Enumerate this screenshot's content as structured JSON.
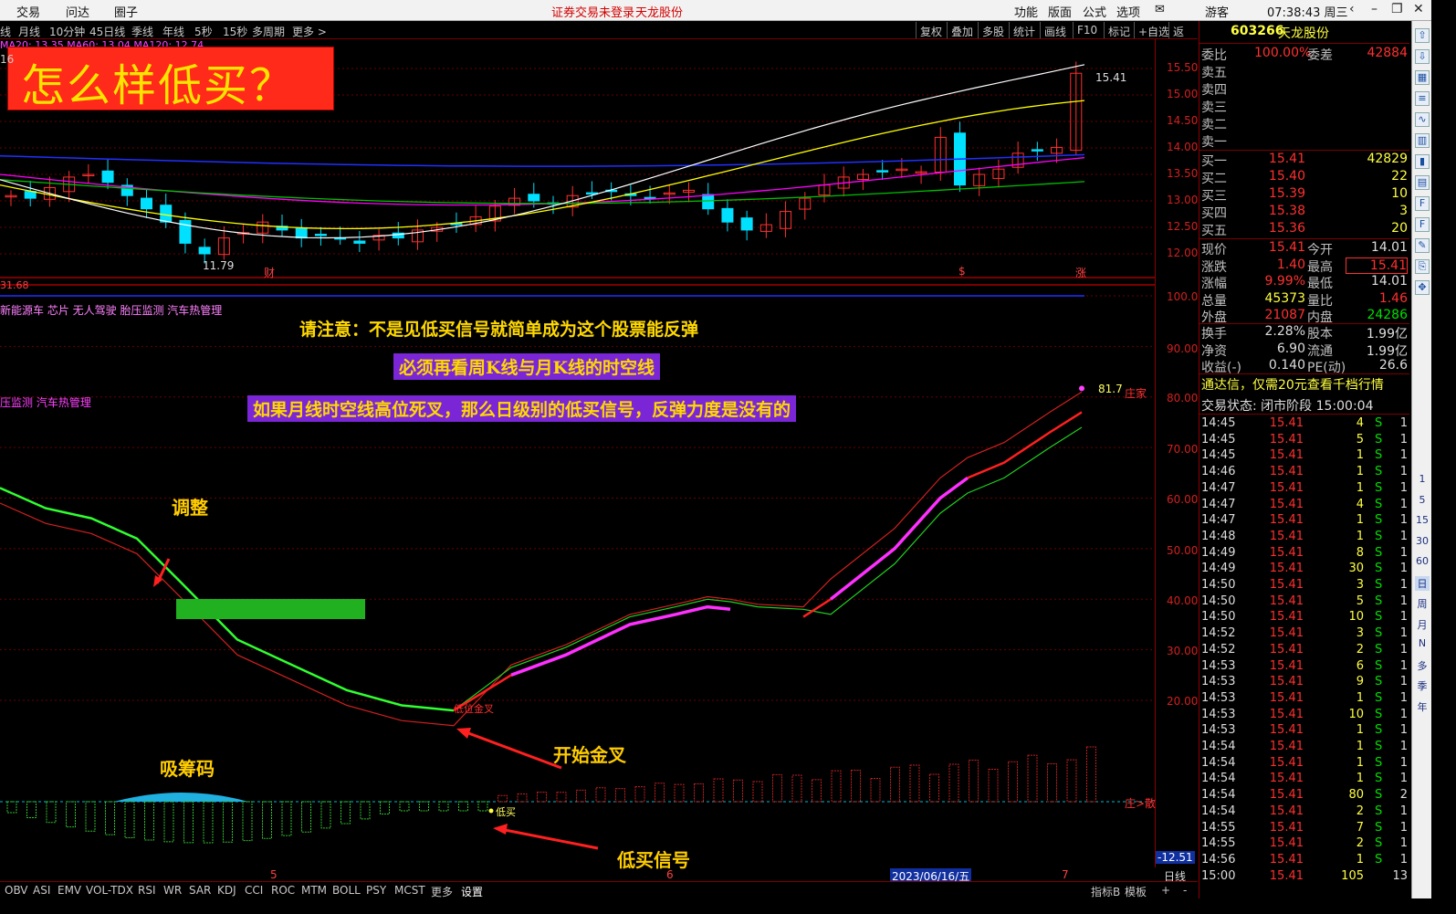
{
  "menubar": {
    "left_items": [
      "交易",
      "问达",
      "圈子"
    ],
    "center_notice_1": "证券交易未登录",
    "center_notice_2": "天龙股份",
    "right_items": [
      "功能",
      "版面",
      "公式",
      "选项"
    ],
    "user": "游客",
    "clock": "07:38:43 周三"
  },
  "toolbar": {
    "periods": [
      "线",
      "月线",
      "10分钟",
      "45日线",
      "季线",
      "年线",
      "5秒",
      "15秒",
      "多周期",
      "更多 >"
    ],
    "tools": [
      "复权",
      "叠加",
      "多股",
      "统计",
      "画线",
      "F10",
      "标记",
      "+自选",
      "返回"
    ],
    "ma_legend": "MA20: 13.35  MA60: 13.04  MA120: 12.74"
  },
  "main_chart": {
    "title_banner": "怎么样低买？",
    "y_ticks": [
      "15.50",
      "15.00",
      "14.50",
      "14.00",
      "13.50",
      "13.00",
      "12.50",
      "12.00"
    ],
    "high_label": "15.41",
    "low_label": "11.79",
    "left_value": "16",
    "left_bottom_value": "31.68",
    "bottom_markers": [
      "财",
      "$",
      "涨"
    ]
  },
  "indicator_chart": {
    "y_ticks": [
      "100.0",
      "90.00",
      "80.00",
      "70.00",
      "60.00",
      "50.00",
      "40.00",
      "30.00",
      "20.00"
    ],
    "concept_line_1": "新能源车 芯片 无人驾驶 胎压监测 汽车热管理",
    "concept_line_2": "压监测 汽车热管理",
    "end_value": "81.7",
    "end_tag": "庄家",
    "cross_label": "低位金叉"
  },
  "notes": {
    "note1": "请注意：不是见低买信号就简单成为这个股票能反弹",
    "note2": "必须再看周K线与月K线的时空线",
    "note3": "如果月线时空线高位死叉，那么日级别的低买信号，反弹力度是没有的"
  },
  "annotations": {
    "adjust": "调整",
    "golden_cross": "开始金叉",
    "absorb": "吸筹码",
    "low_buy_signal": "低买信号",
    "low_buy_tag": "低买",
    "zhuang_tag": "庄>散"
  },
  "bottom_panel": {
    "y_tick": "-12.51"
  },
  "x_axis": {
    "labels": [
      "5",
      "6",
      "2023/06/16/五",
      "7"
    ],
    "period": "日线"
  },
  "bottom_tabs": [
    "OBV",
    "ASI",
    "EMV",
    "VOL-TDX",
    "RSI",
    "WR",
    "SAR",
    "KDJ",
    "CCI",
    "ROC",
    "MTM",
    "BOLL",
    "PSY",
    "MCST",
    "更多",
    "设置"
  ],
  "bottom_right": [
    "指标B",
    "模板",
    "+",
    "-"
  ],
  "quote_panel": {
    "code": "603266",
    "name": "天龙股份",
    "weibi_label": "委比",
    "weibi": "100.00%",
    "weicha_label": "委差",
    "weicha": "42884",
    "sells": [
      {
        "label": "卖五",
        "price": "",
        "vol": ""
      },
      {
        "label": "卖四",
        "price": "",
        "vol": ""
      },
      {
        "label": "卖三",
        "price": "",
        "vol": ""
      },
      {
        "label": "卖二",
        "price": "",
        "vol": ""
      },
      {
        "label": "卖一",
        "price": "",
        "vol": ""
      }
    ],
    "buys": [
      {
        "label": "买一",
        "price": "15.41",
        "vol": "42829"
      },
      {
        "label": "买二",
        "price": "15.40",
        "vol": "22"
      },
      {
        "label": "买三",
        "price": "15.39",
        "vol": "10"
      },
      {
        "label": "买四",
        "price": "15.38",
        "vol": "3"
      },
      {
        "label": "买五",
        "price": "15.36",
        "vol": "20"
      }
    ],
    "stats": [
      {
        "l1": "现价",
        "v1": "15.41",
        "l2": "今开",
        "v2": "14.01"
      },
      {
        "l1": "涨跌",
        "v1": "1.40",
        "l2": "最高",
        "v2": "15.41"
      },
      {
        "l1": "涨幅",
        "v1": "9.99%",
        "l2": "最低",
        "v2": "14.01"
      },
      {
        "l1": "总量",
        "v1": "45373",
        "l2": "量比",
        "v2": "1.46"
      },
      {
        "l1": "外盘",
        "v1": "21087",
        "l2": "内盘",
        "v2": "24286"
      },
      {
        "l1": "换手",
        "v1": "2.28%",
        "l2": "股本",
        "v2": "1.99亿"
      },
      {
        "l1": "净资",
        "v1": "6.90",
        "l2": "流通",
        "v2": "1.99亿"
      },
      {
        "l1": "收益(-)",
        "v1": "0.140",
        "l2": "PE(动)",
        "v2": "26.6"
      }
    ],
    "promo": "通达信，仅需20元查看千档行情",
    "trade_status": "交易状态: 闭市阶段 15:00:04",
    "ticks": [
      {
        "t": "14:45",
        "p": "15.41",
        "v": "4",
        "s": "S",
        "n": "1"
      },
      {
        "t": "14:45",
        "p": "15.41",
        "v": "5",
        "s": "S",
        "n": "1"
      },
      {
        "t": "14:45",
        "p": "15.41",
        "v": "1",
        "s": "S",
        "n": "1"
      },
      {
        "t": "14:46",
        "p": "15.41",
        "v": "1",
        "s": "S",
        "n": "1"
      },
      {
        "t": "14:47",
        "p": "15.41",
        "v": "1",
        "s": "S",
        "n": "1"
      },
      {
        "t": "14:47",
        "p": "15.41",
        "v": "4",
        "s": "S",
        "n": "1"
      },
      {
        "t": "14:47",
        "p": "15.41",
        "v": "1",
        "s": "S",
        "n": "1"
      },
      {
        "t": "14:48",
        "p": "15.41",
        "v": "1",
        "s": "S",
        "n": "1"
      },
      {
        "t": "14:49",
        "p": "15.41",
        "v": "8",
        "s": "S",
        "n": "1"
      },
      {
        "t": "14:49",
        "p": "15.41",
        "v": "30",
        "s": "S",
        "n": "1"
      },
      {
        "t": "14:50",
        "p": "15.41",
        "v": "3",
        "s": "S",
        "n": "1"
      },
      {
        "t": "14:50",
        "p": "15.41",
        "v": "5",
        "s": "S",
        "n": "1"
      },
      {
        "t": "14:50",
        "p": "15.41",
        "v": "10",
        "s": "S",
        "n": "1"
      },
      {
        "t": "14:52",
        "p": "15.41",
        "v": "3",
        "s": "S",
        "n": "1"
      },
      {
        "t": "14:52",
        "p": "15.41",
        "v": "2",
        "s": "S",
        "n": "1"
      },
      {
        "t": "14:53",
        "p": "15.41",
        "v": "6",
        "s": "S",
        "n": "1"
      },
      {
        "t": "14:53",
        "p": "15.41",
        "v": "9",
        "s": "S",
        "n": "1"
      },
      {
        "t": "14:53",
        "p": "15.41",
        "v": "1",
        "s": "S",
        "n": "1"
      },
      {
        "t": "14:53",
        "p": "15.41",
        "v": "10",
        "s": "S",
        "n": "1"
      },
      {
        "t": "14:53",
        "p": "15.41",
        "v": "1",
        "s": "S",
        "n": "1"
      },
      {
        "t": "14:54",
        "p": "15.41",
        "v": "1",
        "s": "S",
        "n": "1"
      },
      {
        "t": "14:54",
        "p": "15.41",
        "v": "1",
        "s": "S",
        "n": "1"
      },
      {
        "t": "14:54",
        "p": "15.41",
        "v": "1",
        "s": "S",
        "n": "1"
      },
      {
        "t": "14:54",
        "p": "15.41",
        "v": "80",
        "s": "S",
        "n": "2"
      },
      {
        "t": "14:54",
        "p": "15.41",
        "v": "2",
        "s": "S",
        "n": "1"
      },
      {
        "t": "14:55",
        "p": "15.41",
        "v": "7",
        "s": "S",
        "n": "1"
      },
      {
        "t": "14:55",
        "p": "15.41",
        "v": "2",
        "s": "S",
        "n": "1"
      },
      {
        "t": "14:56",
        "p": "15.41",
        "v": "1",
        "s": "S",
        "n": "1"
      },
      {
        "t": "15:00",
        "p": "15.41",
        "v": "105",
        "s": "",
        "n": "13"
      }
    ]
  },
  "sidebar_items": [
    "1",
    "5",
    "15",
    "30",
    "60",
    "日",
    "周",
    "月",
    "N",
    "多",
    "季",
    "年"
  ],
  "colors": {
    "up": "#ff3030",
    "down": "#00e0ff",
    "ma_white": "#ffffff",
    "ma_yellow": "#ffff00",
    "ma_magenta": "#ff00ff",
    "ma_green": "#00c000",
    "ma_blue": "#2030ff"
  }
}
